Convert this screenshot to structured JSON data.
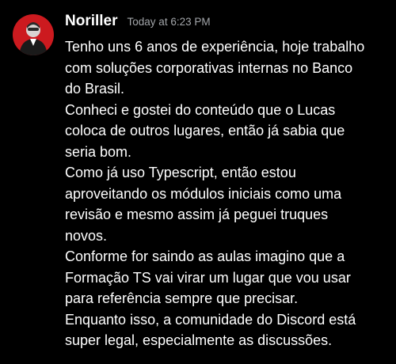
{
  "message": {
    "author": "Noriller",
    "timestamp": "Today at 6:23 PM",
    "avatar_icon": "user-avatar-icon",
    "colors": {
      "background": "#000000",
      "text": "#ffffff",
      "timestamp": "#a3a6aa",
      "avatar_bg": "#cc1a1f"
    },
    "lines": [
      "Tenho uns 6 anos de experiência, hoje trabalho",
      "com soluções corporativas internas no Banco",
      "do Brasil.",
      "Conheci e gostei do conteúdo que o Lucas",
      "coloca de outros lugares, então já sabia que",
      "seria bom.",
      "Como já uso Typescript, então estou",
      "aproveitando os módulos iniciais como uma",
      "revisão e mesmo assim já peguei truques",
      "novos.",
      "Conforme for saindo as aulas imagino que a",
      "Formação TS vai virar um lugar que vou usar",
      "para referência sempre que precisar.",
      "Enquanto isso, a comunidade do Discord está",
      "super legal, especialmente as discussões."
    ]
  }
}
